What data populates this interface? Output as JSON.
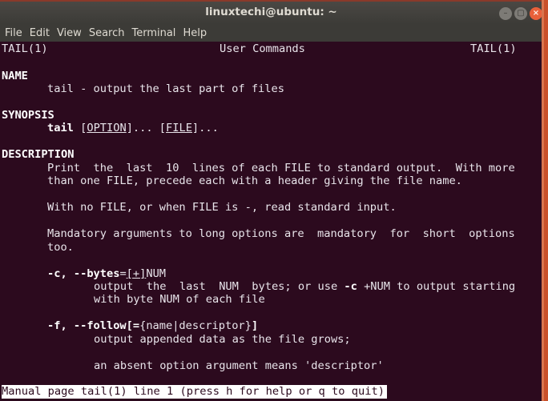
{
  "window": {
    "title": "linuxtechi@ubuntu: ~",
    "buttons": {
      "minimize": "–",
      "maximize": "▢",
      "close": "×"
    }
  },
  "menu": [
    "File",
    "Edit",
    "View",
    "Search",
    "Terminal",
    "Help"
  ],
  "manpage": {
    "header_left": "TAIL(1)",
    "header_center": "User Commands",
    "header_right": "TAIL(1)",
    "name_heading": "NAME",
    "name_text": "tail - output the last part of files",
    "synopsis_heading": "SYNOPSIS",
    "synopsis": {
      "cmd": "tail",
      "open1": "[",
      "option": "OPTION",
      "close1": "]... ",
      "open2": "[",
      "file": "FILE",
      "close2": "]..."
    },
    "description_heading": "DESCRIPTION",
    "desc_lines": [
      "Print  the  last  10  lines of each FILE to standard output.  With more",
      "than one FILE, precede each with a header giving the file name.",
      "With no FILE, or when FILE is -, read standard input.",
      "Mandatory arguments to long options are  mandatory  for  short  options",
      "too."
    ],
    "opt_c": {
      "flag": "-c, --bytes",
      "eq": "=",
      "bracket": "[+]",
      "arg": "NUM",
      "desc1_pre": "output  the  last  NUM  bytes; or use ",
      "desc1_bold": "-c",
      "desc1_post": " +NUM to output starting",
      "desc2": "with byte NUM of each file"
    },
    "opt_f": {
      "flag": "-f, --follow",
      "bracket_open": "[=",
      "arg": "{name|descriptor}",
      "bracket_close": "]",
      "desc1": "output appended data as the file grows;",
      "desc2": "an absent option argument means 'descriptor'"
    }
  },
  "status": "Manual page tail(1) line 1 (press h for help or q to quit)"
}
